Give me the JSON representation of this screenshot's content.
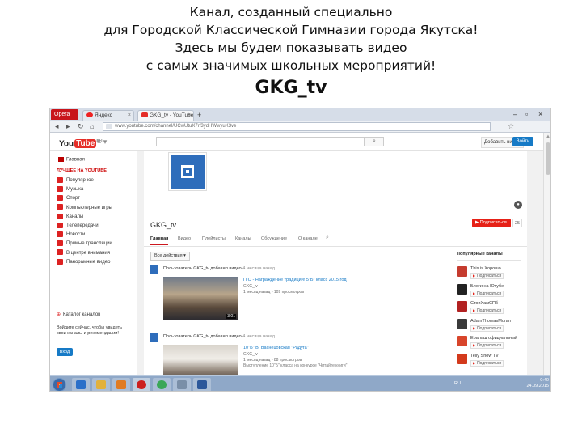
{
  "slide": {
    "heading_lines": [
      "Канал, созданный специально",
      "для Городской Классической Гимназии города Якутска!",
      "Здесь мы будем показывать видео",
      "с самых значимых школьных мероприятий!"
    ],
    "channel_title": "GKG_tv"
  },
  "browser": {
    "menu_label": "Opera",
    "tabs": [
      {
        "label": "Яндекс"
      },
      {
        "label": "GKG_tv - YouTube"
      }
    ],
    "new_tab_icon": "plus-icon",
    "url": "www.youtube.com/channel/UCwUtuX7rf3ydHWwyuK3ve"
  },
  "youtube": {
    "logo_you": "You",
    "logo_tube": "Tube",
    "logo_region": "RU",
    "upload_label": "Добавить видео",
    "signin_label": "Войти",
    "guide": {
      "home": "Главная",
      "heading": "ЛУЧШЕЕ НА YOUTUBE",
      "items": [
        "Популярное",
        "Музыка",
        "Спорт",
        "Компьютерные игры",
        "Каналы",
        "Телепередачи",
        "Новости",
        "Прямые трансляции",
        "В центре внимания",
        "Панорамные видео"
      ],
      "catalog": "Каталог каналов",
      "promo": "Войдите сейчас, чтобы увидеть свои каналы и рекомендации!",
      "login": "Вход"
    },
    "channel": {
      "name": "GKG_tv",
      "subscribe_label": "Подписаться",
      "subscriber_count": "25",
      "tabs": [
        "Главная",
        "Видео",
        "Плейлисты",
        "Каналы",
        "Обсуждение",
        "О канале"
      ],
      "active_tab": 0,
      "feed_filter": "Все действия ▾",
      "feed": [
        {
          "header": "Пользователь GKG_tv добавил видео",
          "when": "4 месяца назад",
          "title": "ГГО - Награждение традиций! 5\"Б\" класс 2015 год",
          "by": "GKG_tv",
          "meta": "1 месяц назад • 109 просмотров",
          "duration": "3:01"
        },
        {
          "header": "Пользователь GKG_tv добавил видео",
          "when": "4 месяца назад",
          "title": "10\"Б\" В. Васнецовская \"Радуга\"",
          "by": "GKG_tv",
          "meta": "1 месяц назад • 88 просмотров",
          "desc": "Выступление 10\"Б\" класса на конкурсе \"Читайте книги\"",
          "duration": ""
        }
      ]
    },
    "popular": {
      "heading": "Популярные каналы",
      "subscribe_label": "Подписаться",
      "channels": [
        {
          "name": "This is Хорошо",
          "color": "#c53b2e"
        },
        {
          "name": "Блоги на Ютубе",
          "color": "#222222"
        },
        {
          "name": "СтопХамСПб",
          "color": "#b22222"
        },
        {
          "name": "AdamThomasMoran",
          "color": "#3a3a3a"
        },
        {
          "name": "Ералаш официальный",
          "color": "#d8452b"
        },
        {
          "name": "Telly Show TV",
          "color": "#d33a1c"
        }
      ]
    }
  },
  "taskbar": {
    "apps": [
      {
        "name": "internet-explorer-icon",
        "color": "#2a6fc9"
      },
      {
        "name": "file-explorer-icon",
        "color": "#e2b13c"
      },
      {
        "name": "media-player-icon",
        "color": "#e07b22"
      },
      {
        "name": "opera-icon",
        "color": "#cc1f1f"
      },
      {
        "name": "chrome-icon",
        "color": "#3aa757"
      },
      {
        "name": "picture-viewer-icon",
        "color": "#7a8fa8"
      },
      {
        "name": "word-icon",
        "color": "#2b579a"
      }
    ],
    "lang": "RU",
    "time": "0:40",
    "date": "24.09.2015"
  },
  "colors": {
    "youtube_red": "#e62117",
    "signin_blue": "#167ac6",
    "channel_avatar": "#2e6dbb",
    "taskbar": "#8fa8c8"
  }
}
